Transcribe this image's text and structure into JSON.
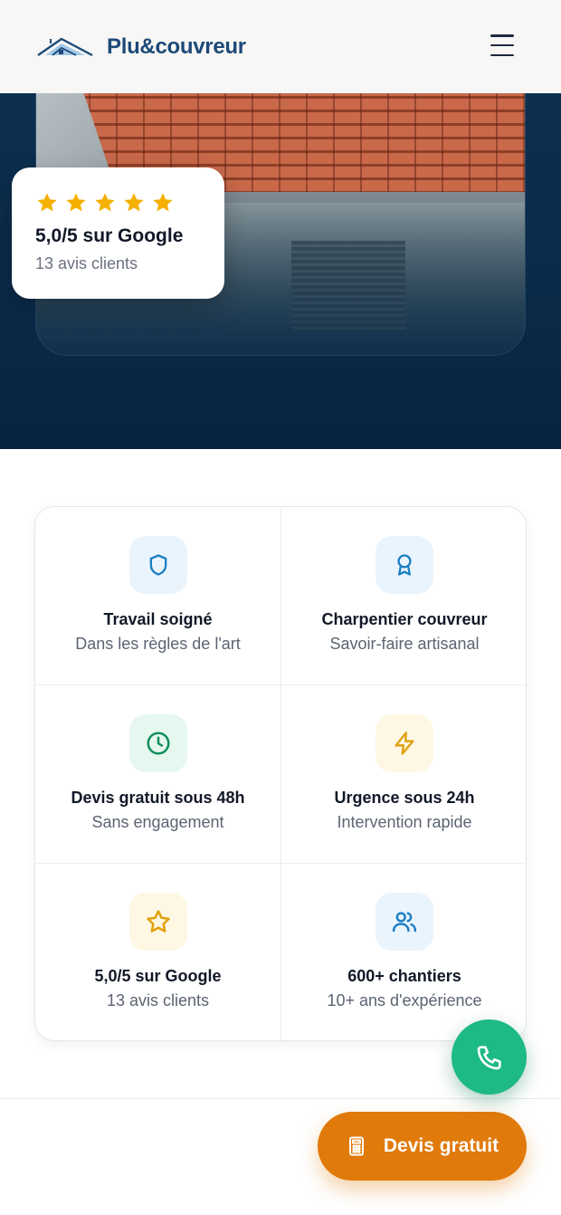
{
  "header": {
    "brand": "Plu&couvreur",
    "logo_icon": "house-roof-logo-icon",
    "menu_icon": "hamburger-menu-icon"
  },
  "hero": {
    "rating_card": {
      "stars": 5,
      "star_color": "#f5b000",
      "title": "5,0/5 sur Google",
      "subtitle": "13 avis clients"
    }
  },
  "features": [
    {
      "icon": "shield-icon",
      "color": "#1d7fc4",
      "title": "Travail soigné",
      "subtitle": "Dans les règles de l'art"
    },
    {
      "icon": "award-ribbon-icon",
      "color": "#1d7fc4",
      "title": "Charpentier couvreur",
      "subtitle": "Savoir-faire artisanal"
    },
    {
      "icon": "clock-icon",
      "color": "#0f8f5b",
      "title": "Devis gratuit sous 48h",
      "subtitle": "Sans engagement"
    },
    {
      "icon": "lightning-icon",
      "color": "#e0a10b",
      "title": "Urgence sous 24h",
      "subtitle": "Intervention rapide"
    },
    {
      "icon": "star-outline-icon",
      "color": "#e0a10b",
      "title": "5,0/5 sur Google",
      "subtitle": "13 avis clients"
    },
    {
      "icon": "users-icon",
      "color": "#1d7fc4",
      "title": "600+ chantiers",
      "subtitle": "10+ ans d'expérience"
    }
  ],
  "actions": {
    "call_icon": "phone-icon",
    "call_color": "#1dba83",
    "quote_icon": "calculator-icon",
    "quote_label": "Devis gratuit",
    "quote_color": "#e07a0b"
  }
}
